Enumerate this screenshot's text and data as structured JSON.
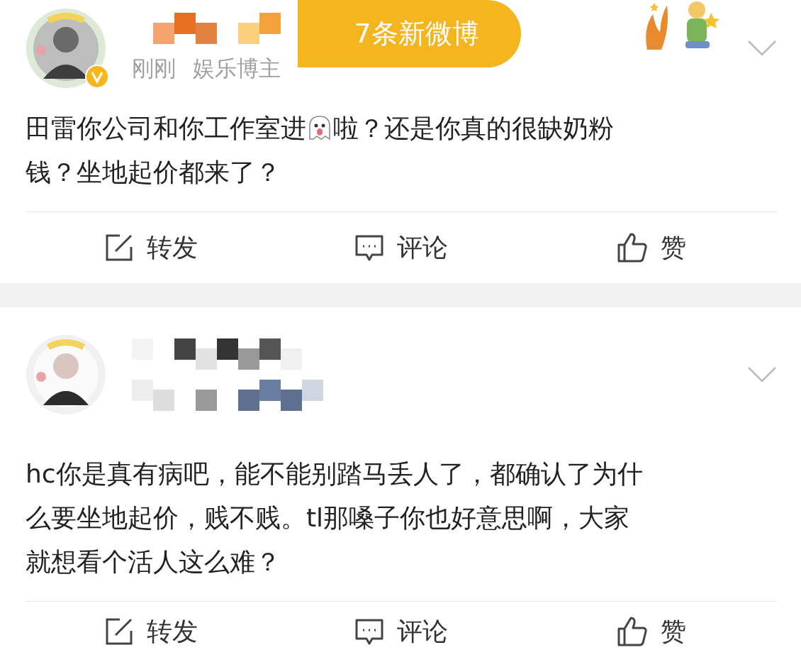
{
  "posts": [
    {
      "time": "刚刚",
      "tag": "娱乐博主",
      "verified": true,
      "decoration": true,
      "lines": [
        [
          {
            "kind": "text",
            "text": "田雷你公司和你工作室进"
          },
          {
            "kind": "ghost"
          },
          {
            "kind": "text",
            "text": "啦？还是你真的很缺奶粉"
          }
        ],
        [
          {
            "kind": "text",
            "text": "钱？坐地起价都来了？"
          }
        ]
      ],
      "actions": [
        {
          "kind": "repost",
          "label": "转发"
        },
        {
          "kind": "comment",
          "label": "评论"
        },
        {
          "kind": "like",
          "label": "赞"
        }
      ]
    },
    {
      "verified": false,
      "decoration": false,
      "lines": [
        [
          {
            "kind": "text",
            "text": "hc你是真有病吧，能不能别踏马丢人了，都确认了为什"
          }
        ],
        [
          {
            "kind": "text",
            "text": "么要坐地起价，贱不贱。tl那嗓子你也好意思啊，大家"
          }
        ],
        [
          {
            "kind": "text",
            "text": "就想看个活人这么难？"
          }
        ]
      ],
      "actions": [
        {
          "kind": "repost",
          "label": "转发"
        },
        {
          "kind": "comment",
          "label": "评论"
        },
        {
          "kind": "like",
          "label": "赞"
        }
      ]
    }
  ],
  "new_posts_badge": "7条新微博"
}
